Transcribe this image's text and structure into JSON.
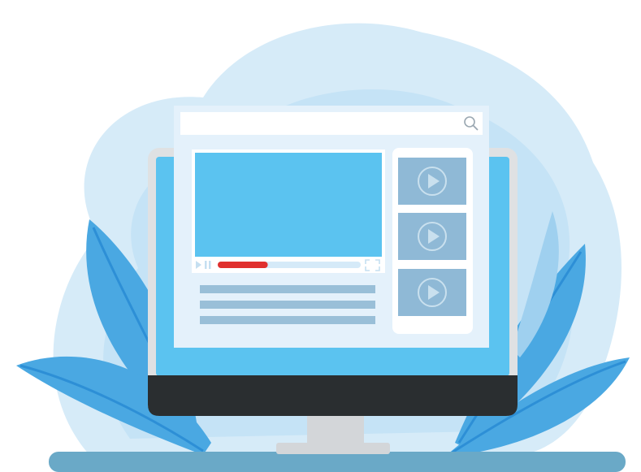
{
  "illustration": {
    "subject": "video-player-website-on-desktop-monitor",
    "colors": {
      "blob_light": "#d6ebf8",
      "blob_mid": "#bfe0f6",
      "leaf": "#4aa8e2",
      "leaf_dark": "#2d8fd6",
      "monitor_frame": "#dfe1e3",
      "monitor_screen": "#5bc3f0",
      "monitor_chin": "#2a2e30",
      "stand": "#d3d6d9",
      "desk": "#6aa9c7",
      "browser_bg": "#e4f1fb",
      "search_bar": "#ffffff",
      "video_area": "#5bc3f0",
      "progress_played": "#e0302e",
      "progress_track": "#d5eaf8",
      "thumb_bg": "#8fb9d6",
      "text_line": "#99bfd8"
    },
    "icons": [
      "search-icon",
      "play-icon",
      "pause-icon",
      "fullscreen-icon"
    ],
    "video_progress": 0.35,
    "thumbnail_count": 3,
    "text_line_count": 3
  }
}
